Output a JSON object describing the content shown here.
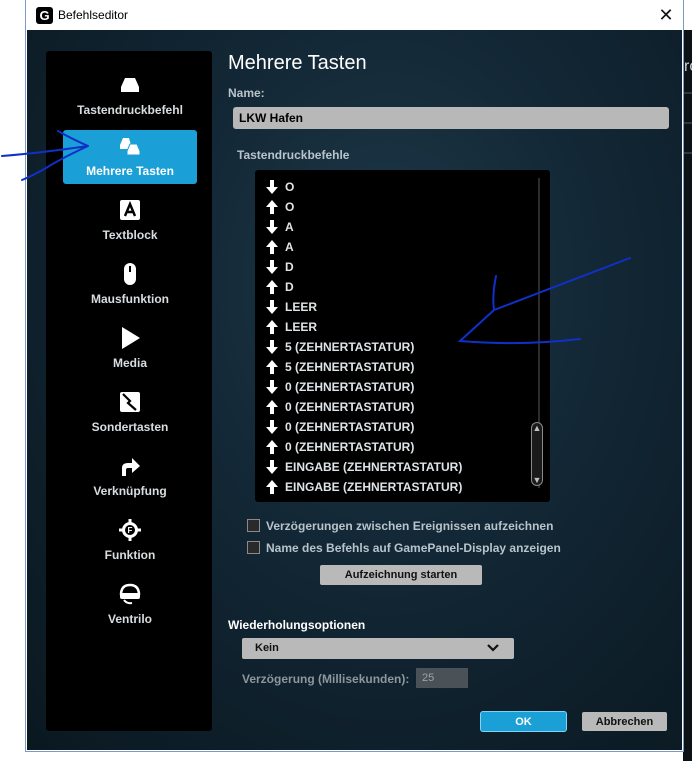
{
  "window": {
    "title": "Befehlseditor",
    "close_symbol": "✕",
    "logo_letter": "G"
  },
  "background": {
    "fragment_text": "ro"
  },
  "sidebar": {
    "items": [
      {
        "label": "Tastendruckbefehl",
        "icon": "keystroke-icon",
        "active": false
      },
      {
        "label": "Mehrere Tasten",
        "icon": "multikey-icon",
        "active": true
      },
      {
        "label": "Textblock",
        "icon": "textblock-icon",
        "active": false
      },
      {
        "label": "Mausfunktion",
        "icon": "mouse-icon",
        "active": false
      },
      {
        "label": "Media",
        "icon": "play-icon",
        "active": false
      },
      {
        "label": "Sondertasten",
        "icon": "hotkey-icon",
        "active": false
      },
      {
        "label": "Verknüpfung",
        "icon": "shortcut-arrow-icon",
        "active": false
      },
      {
        "label": "Funktion",
        "icon": "function-gear-icon",
        "active": false
      },
      {
        "label": "Ventrilo",
        "icon": "headset-icon",
        "active": false
      }
    ]
  },
  "main": {
    "heading": "Mehrere Tasten",
    "name_label": "Name:",
    "name_value": "LKW Hafen",
    "commands_label": "Tastendruckbefehle",
    "commands": [
      {
        "dir": "down",
        "key": "O"
      },
      {
        "dir": "up",
        "key": "O"
      },
      {
        "dir": "down",
        "key": "A"
      },
      {
        "dir": "up",
        "key": "A"
      },
      {
        "dir": "down",
        "key": "D"
      },
      {
        "dir": "up",
        "key": "D"
      },
      {
        "dir": "down",
        "key": "LEER"
      },
      {
        "dir": "up",
        "key": "LEER"
      },
      {
        "dir": "down",
        "key": "5 (ZEHNERTASTATUR)"
      },
      {
        "dir": "up",
        "key": "5 (ZEHNERTASTATUR)"
      },
      {
        "dir": "down",
        "key": "0 (ZEHNERTASTATUR)"
      },
      {
        "dir": "up",
        "key": "0 (ZEHNERTASTATUR)"
      },
      {
        "dir": "down",
        "key": "0 (ZEHNERTASTATUR)"
      },
      {
        "dir": "up",
        "key": "0 (ZEHNERTASTATUR)"
      },
      {
        "dir": "down",
        "key": "EINGABE (ZEHNERTASTATUR)"
      },
      {
        "dir": "up",
        "key": "EINGABE (ZEHNERTASTATUR)"
      }
    ],
    "checkbox_record_delays": {
      "label": "Verzögerungen zwischen Ereignissen aufzeichnen",
      "checked": false
    },
    "checkbox_gamepanel": {
      "label": "Name des Befehls auf GamePanel-Display anzeigen",
      "checked": false
    },
    "record_button": "Aufzeichnung starten",
    "repeat_label": "Wiederholungsoptionen",
    "repeat_select_value": "Kein",
    "delay_label": "Verzögerung (Millisekunden):",
    "delay_value": "25",
    "ok_button": "OK",
    "cancel_button": "Abbrechen"
  },
  "colors": {
    "accent": "#1a9fd6",
    "annotation_ink": "#1030c8",
    "list_background": "#000000",
    "sidebar_background": "#000000"
  }
}
